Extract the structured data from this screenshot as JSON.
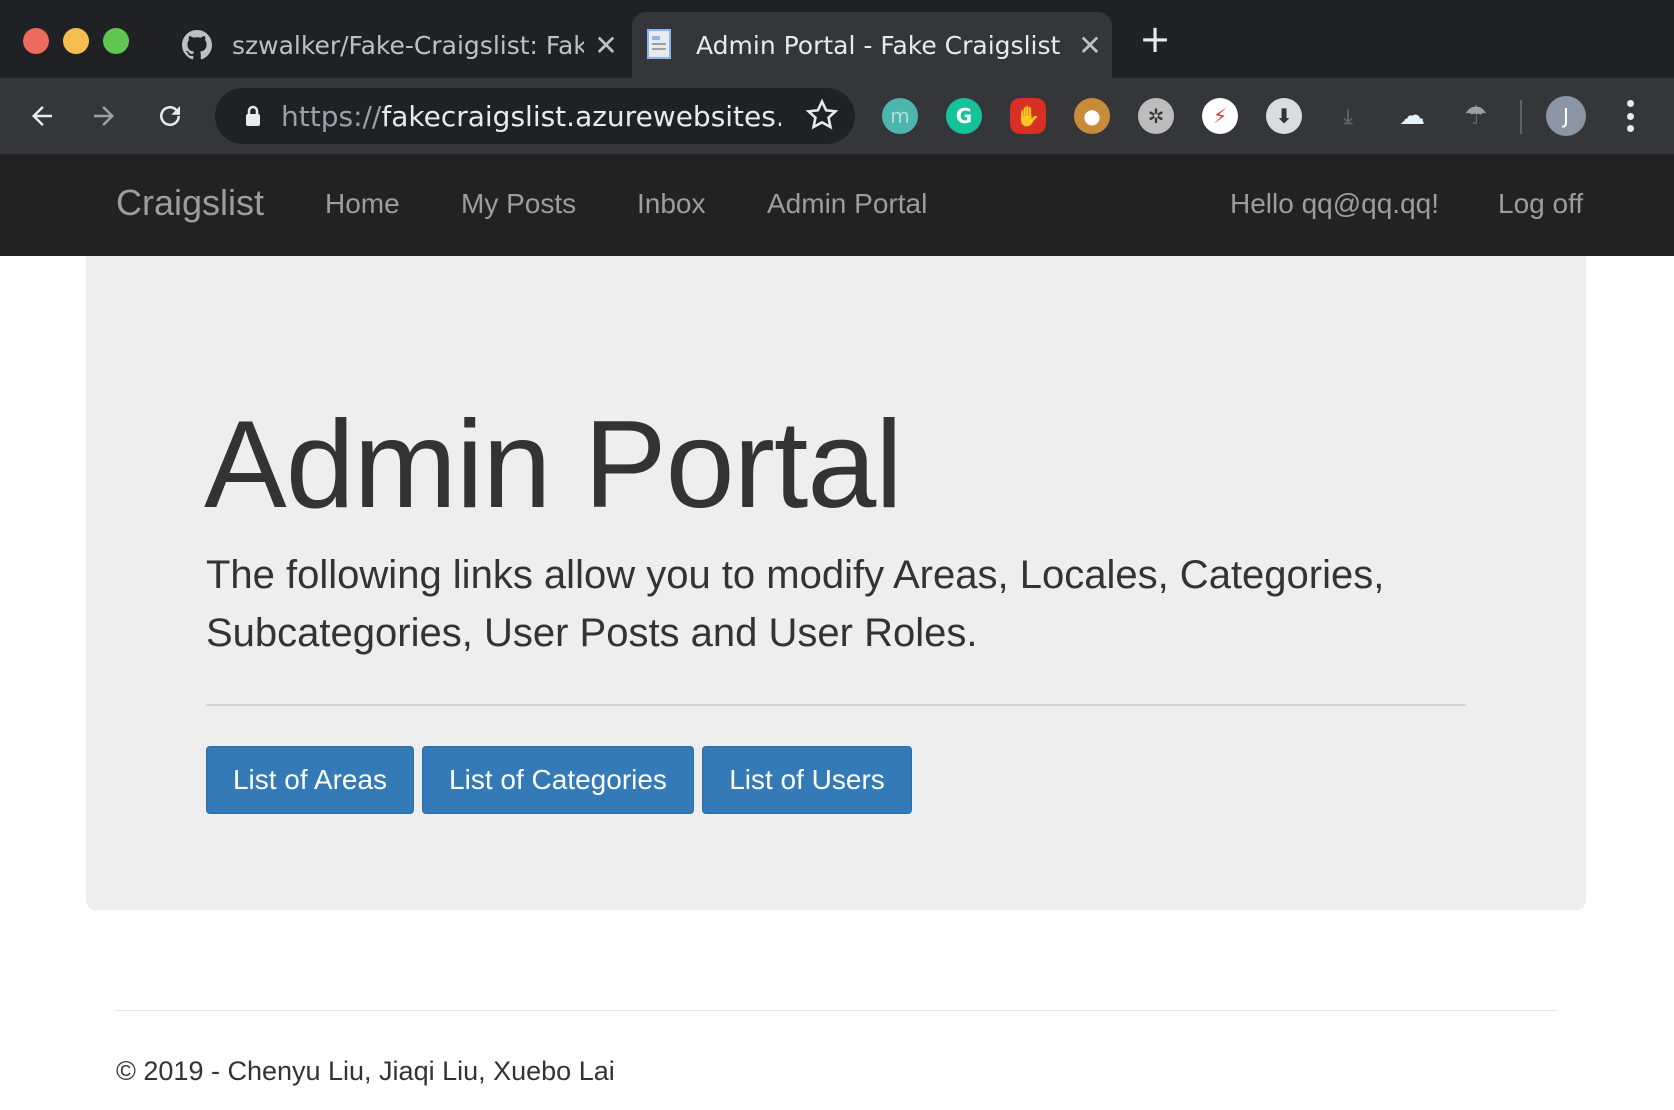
{
  "browser": {
    "tabs": [
      {
        "title": "szwalker/Fake-Craigslist: Fake",
        "icon": "github-icon"
      },
      {
        "title": "Admin Portal - Fake Craigslist",
        "icon": "document-icon"
      }
    ],
    "url_scheme": "https://",
    "url_rest": "fakecraigslist.azurewebsites...",
    "profile_initial": "J"
  },
  "navbar": {
    "brand": "Craigslist",
    "links": [
      "Home",
      "My Posts",
      "Inbox",
      "Admin Portal"
    ],
    "greeting": "Hello qq@qq.qq!",
    "logoff": "Log off"
  },
  "jumbotron": {
    "title": "Admin Portal",
    "lead": "The following links allow you to modify Areas, Locales, Categories, Subcategories, User Posts and User Roles.",
    "buttons": [
      "List of Areas",
      "List of Categories",
      "List of Users"
    ]
  },
  "footer": {
    "text": "© 2019 - Chenyu Liu, Jiaqi Liu, Xuebo Lai"
  },
  "colors": {
    "navbar_bg": "#222222",
    "jumbotron_bg": "#eeeeee",
    "button_primary": "#337ab7"
  }
}
